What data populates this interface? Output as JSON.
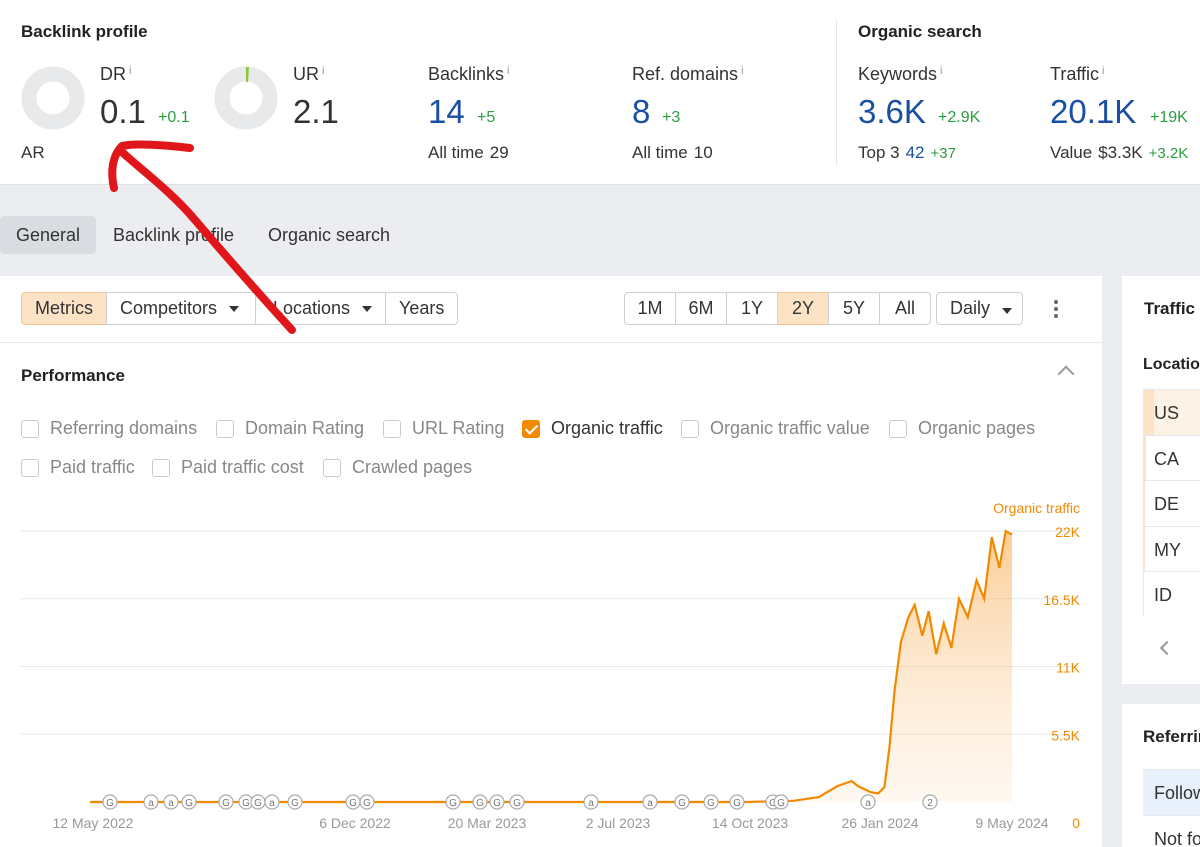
{
  "backlink_profile": {
    "title": "Backlink profile",
    "dr": {
      "label": "DR",
      "info": "i",
      "value": "0.1",
      "delta": "+0.1",
      "sub": "AR",
      "ring_fill": 0.0
    },
    "ur": {
      "label": "UR",
      "info": "i",
      "value": "2.1",
      "ring_fill": 0.021
    },
    "backlinks": {
      "label": "Backlinks",
      "info": "i",
      "value": "14",
      "delta": "+5",
      "sub_label": "All time",
      "sub_value": "29"
    },
    "ref_domains": {
      "label": "Ref. domains",
      "info": "i",
      "value": "8",
      "delta": "+3",
      "sub_label": "All time",
      "sub_value": "10"
    }
  },
  "organic_search": {
    "title": "Organic search",
    "keywords": {
      "label": "Keywords",
      "info": "i",
      "value": "3.6K",
      "delta": "+2.9K",
      "sub_label": "Top 3",
      "sub_value": "42",
      "sub_delta": "+37"
    },
    "traffic": {
      "label": "Traffic",
      "info": "i",
      "value": "20.1K",
      "delta": "+19K",
      "sub_label": "Value",
      "sub_value": "$3.3K",
      "sub_delta": "+3.2K"
    }
  },
  "tabs": [
    {
      "label": "General",
      "active": true
    },
    {
      "label": "Backlink profile",
      "active": false
    },
    {
      "label": "Organic search",
      "active": false
    }
  ],
  "toolbar": {
    "metrics": "Metrics",
    "competitors": "Competitors",
    "locations": "Locations",
    "years": "Years",
    "ranges": [
      "1M",
      "6M",
      "1Y",
      "2Y",
      "5Y",
      "All"
    ],
    "active_range": "2Y",
    "granularity": "Daily"
  },
  "performance": {
    "title": "Performance",
    "checkboxes_row1": [
      {
        "label": "Referring domains",
        "checked": false
      },
      {
        "label": "Domain Rating",
        "checked": false
      },
      {
        "label": "URL Rating",
        "checked": false
      },
      {
        "label": "Organic traffic",
        "checked": true
      },
      {
        "label": "Organic traffic value",
        "checked": false
      },
      {
        "label": "Organic pages",
        "checked": false
      }
    ],
    "checkboxes_row2": [
      {
        "label": "Paid traffic",
        "checked": false
      },
      {
        "label": "Paid traffic cost",
        "checked": false
      },
      {
        "label": "Crawled pages",
        "checked": false
      }
    ]
  },
  "chart_data": {
    "type": "area",
    "title": "",
    "series": [
      {
        "name": "Organic traffic",
        "color": "#f28a00"
      }
    ],
    "x_tick_labels": [
      "12 May 2022",
      "6 Dec 2022",
      "20 Mar 2023",
      "2 Jul 2023",
      "14 Oct 2023",
      "26 Jan 2024",
      "9 May 2024"
    ],
    "y_tick_labels": [
      "22K",
      "16.5K",
      "11K",
      "5.5K",
      "0"
    ],
    "ylim": [
      0,
      22000
    ],
    "xlim": [
      "2022-05-12",
      "2024-05-20"
    ],
    "points": [
      [
        "2022-05-12",
        0
      ],
      [
        "2023-10-14",
        0
      ],
      [
        "2023-11-20",
        100
      ],
      [
        "2023-12-10",
        400
      ],
      [
        "2023-12-25",
        1300
      ],
      [
        "2024-01-05",
        1700
      ],
      [
        "2024-01-10",
        1300
      ],
      [
        "2024-01-20",
        800
      ],
      [
        "2024-01-26",
        700
      ],
      [
        "2024-01-31",
        1200
      ],
      [
        "2024-02-04",
        4500
      ],
      [
        "2024-02-08",
        9000
      ],
      [
        "2024-02-13",
        13000
      ],
      [
        "2024-02-19",
        15000
      ],
      [
        "2024-02-24",
        16000
      ],
      [
        "2024-03-01",
        13500
      ],
      [
        "2024-03-06",
        15500
      ],
      [
        "2024-03-12",
        12000
      ],
      [
        "2024-03-18",
        14500
      ],
      [
        "2024-03-24",
        12500
      ],
      [
        "2024-03-30",
        16500
      ],
      [
        "2024-04-06",
        15000
      ],
      [
        "2024-04-13",
        18000
      ],
      [
        "2024-04-19",
        16500
      ],
      [
        "2024-04-25",
        21500
      ],
      [
        "2024-05-01",
        19000
      ],
      [
        "2024-05-06",
        22000
      ],
      [
        "2024-05-11",
        21700
      ]
    ],
    "annotations": [
      "G",
      "a",
      "a",
      "G",
      "G",
      "G",
      "G",
      "a",
      "G",
      "G",
      "G",
      "G",
      "G",
      "G",
      "G",
      "a",
      "a",
      "G",
      "G",
      "G",
      "G",
      "G",
      "a",
      "2"
    ]
  },
  "traffic_by_location": {
    "title": "Traffic",
    "column": "Location",
    "rows": [
      {
        "code": "US",
        "share": 0.55
      },
      {
        "code": "CA",
        "share": 0.14
      },
      {
        "code": "DE",
        "share": 0.1
      },
      {
        "code": "MY",
        "share": 0.08
      },
      {
        "code": "ID",
        "share": 0.07
      }
    ]
  },
  "referring": {
    "title": "Referring",
    "rows": [
      "Follow",
      "Not fo"
    ]
  }
}
